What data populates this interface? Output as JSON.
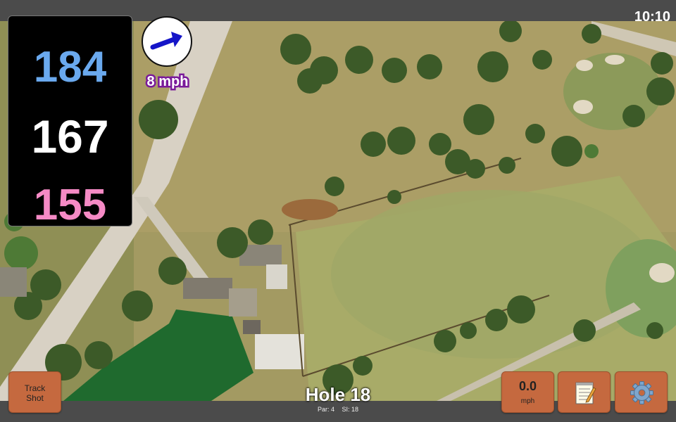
{
  "status_bar": {
    "time": "10:10"
  },
  "distances": {
    "back": "184",
    "middle": "167",
    "front": "155"
  },
  "wind": {
    "speed_label": "8 mph",
    "direction_icon": "arrow-right-icon",
    "arrow_color": "#1515c8"
  },
  "hole": {
    "title": "Hole 18",
    "par_label": "Par: 4",
    "si_label": "SI: 18"
  },
  "buttons": {
    "track_shot_line1": "Track",
    "track_shot_line2": "Shot",
    "speed_value": "0.0",
    "speed_unit": "mph",
    "notes_icon": "notepad-icon",
    "settings_icon": "gear-icon"
  },
  "colors": {
    "back": "#6aa9ee",
    "middle": "#ffffff",
    "front": "#f58ac5",
    "button": "#c5693f",
    "wind_label_outline": "#7a1a9a"
  }
}
